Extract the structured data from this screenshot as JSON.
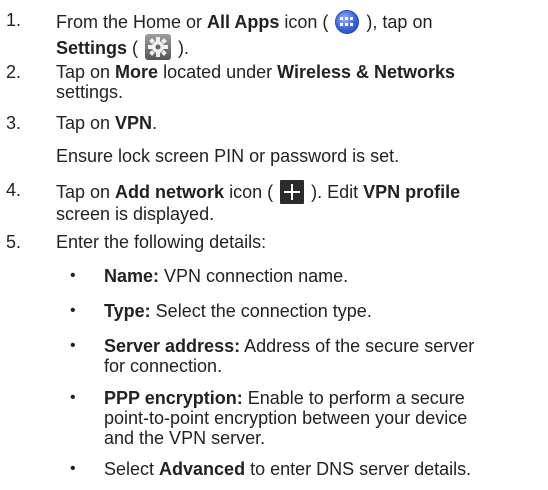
{
  "steps": [
    {
      "number": "1.",
      "line1_a": "From the Home or ",
      "line1_b": "All Apps",
      "line1_c": " icon ( ",
      "line1_d": " ), tap on",
      "line2_a": "Settings",
      "line2_b": " ( ",
      "line2_c": " )."
    },
    {
      "number": "2.",
      "a": "Tap on ",
      "b": "More",
      "c": " located under ",
      "d": "Wireless & Networks",
      "e": "settings."
    },
    {
      "number": "3.",
      "a": "Tap on ",
      "b": "VPN",
      "c": ".",
      "note": "Ensure lock screen PIN or password is set."
    },
    {
      "number": "4.",
      "a": "Tap on ",
      "b": "Add network",
      "c": " icon ( ",
      "d": " ). Edit ",
      "e": "VPN profile",
      "f": "screen is displayed."
    },
    {
      "number": "5.",
      "a": "Enter the following details:"
    }
  ],
  "bullets": [
    {
      "symbol": "•",
      "label": "Name:",
      "text": " VPN connection name."
    },
    {
      "symbol": "•",
      "label": "Type:",
      "text": " Select the connection type."
    },
    {
      "symbol": "•",
      "label": "Server address:",
      "text": " Address of the secure server",
      "text2": "for connection."
    },
    {
      "symbol": "•",
      "label": "PPP encryption:",
      "text": " Enable to perform a secure",
      "text2": "point-to-point encryption between your device",
      "text3": "and the VPN server."
    },
    {
      "symbol": "•",
      "pre": "Select ",
      "label": "Advanced",
      "text": " to enter DNS server details."
    }
  ],
  "icons": {
    "all_apps": "all-apps-icon",
    "settings": "settings-gear-icon",
    "add": "add-plus-icon"
  }
}
